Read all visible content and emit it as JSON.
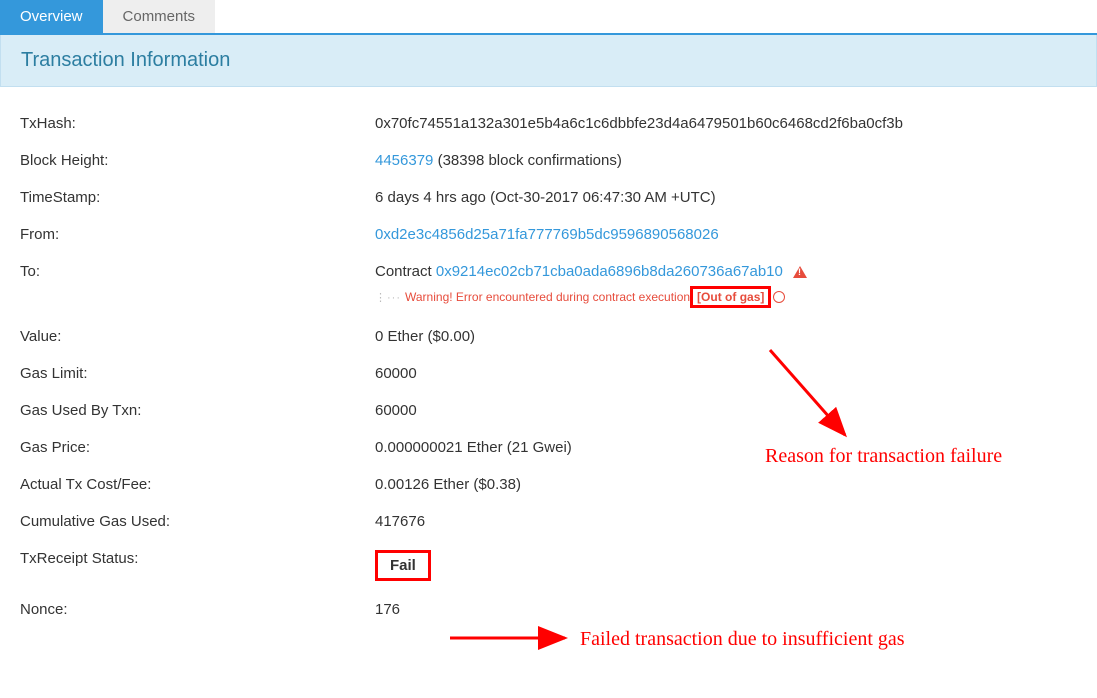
{
  "tabs": {
    "overview": "Overview",
    "comments": "Comments"
  },
  "panel_title": "Transaction Information",
  "rows": {
    "txhash": {
      "label": "TxHash:",
      "value": "0x70fc74551a132a301e5b4a6c1c6dbbfe23d4a6479501b60c6468cd2f6ba0cf3b"
    },
    "block": {
      "label": "Block Height:",
      "link": "4456379",
      "suffix": " (38398 block confirmations)"
    },
    "timestamp": {
      "label": "TimeStamp:",
      "value": "6 days 4 hrs ago (Oct-30-2017 06:47:30 AM +UTC)"
    },
    "from": {
      "label": "From:",
      "link": "0xd2e3c4856d25a71fa777769b5dc9596890568026"
    },
    "to": {
      "label": "To:",
      "prefix": "Contract ",
      "link": "0x9214ec02cb71cba0ada6896b8da260736a67ab10",
      "warning_prefix": "Warning! Error encountered during contract execution ",
      "warning_reason": "[Out of gas]"
    },
    "value": {
      "label": "Value:",
      "value": "0 Ether ($0.00)"
    },
    "gas_limit": {
      "label": "Gas Limit:",
      "value": "60000"
    },
    "gas_used": {
      "label": "Gas Used By Txn:",
      "value": "60000"
    },
    "gas_price": {
      "label": "Gas Price:",
      "value": "0.000000021 Ether (21 Gwei)"
    },
    "cost": {
      "label": "Actual Tx Cost/Fee:",
      "value": "0.00126 Ether ($0.38)"
    },
    "cumulative": {
      "label": "Cumulative Gas Used:",
      "value": "417676"
    },
    "receipt": {
      "label": "TxReceipt Status:",
      "value": "Fail"
    },
    "nonce": {
      "label": "Nonce:",
      "value": "176"
    }
  },
  "annotations": {
    "reason": "Reason for transaction failure",
    "failed": "Failed transaction due to insufficient gas"
  }
}
